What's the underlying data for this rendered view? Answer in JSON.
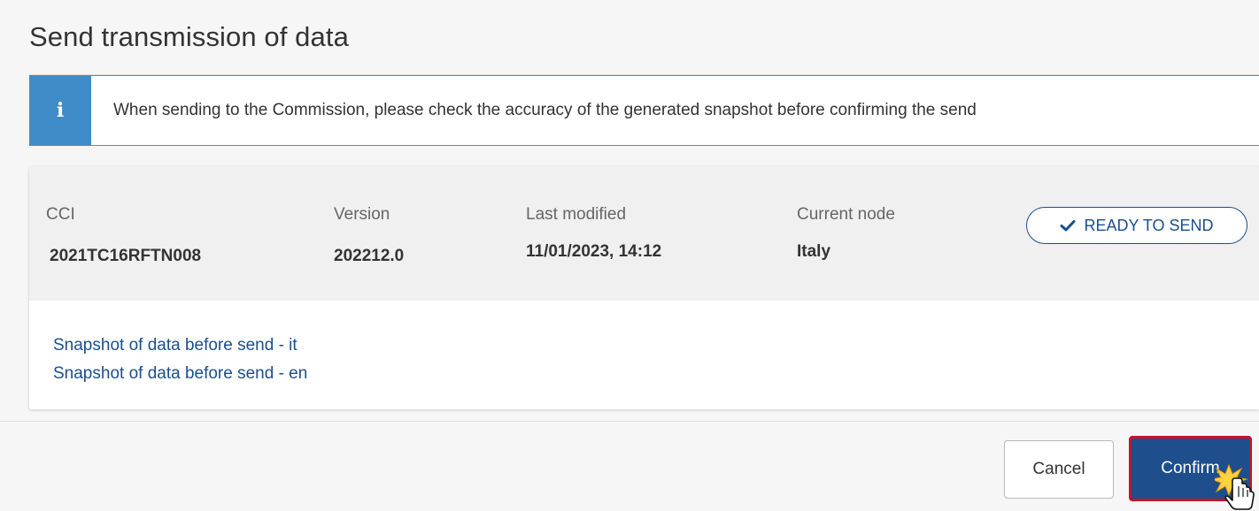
{
  "dialog": {
    "title": "Send transmission of data",
    "alert": {
      "icon": "info-icon",
      "text": "When sending to the Commission, please check the accuracy of the generated snapshot before confirming the send"
    },
    "details": {
      "cci": {
        "label": "CCI",
        "value": "2021TC16RFTN008"
      },
      "version": {
        "label": "Version",
        "value": "202212.0"
      },
      "last_modified": {
        "label": "Last modified",
        "value": "11/01/2023, 14:12"
      },
      "current_node": {
        "label": "Current node",
        "value": "Italy"
      },
      "status": {
        "icon": "check-icon",
        "label": "READY TO SEND"
      }
    },
    "snapshots": [
      {
        "label": "Snapshot of data before send -  it"
      },
      {
        "label": "Snapshot of data before send - en"
      }
    ],
    "buttons": {
      "cancel": "Cancel",
      "confirm": "Confirm"
    }
  },
  "colors": {
    "accent": "#1f4e8c",
    "info": "#3f8cc9",
    "confirm_border": "#c8102e",
    "link": "#1a4f8c"
  }
}
